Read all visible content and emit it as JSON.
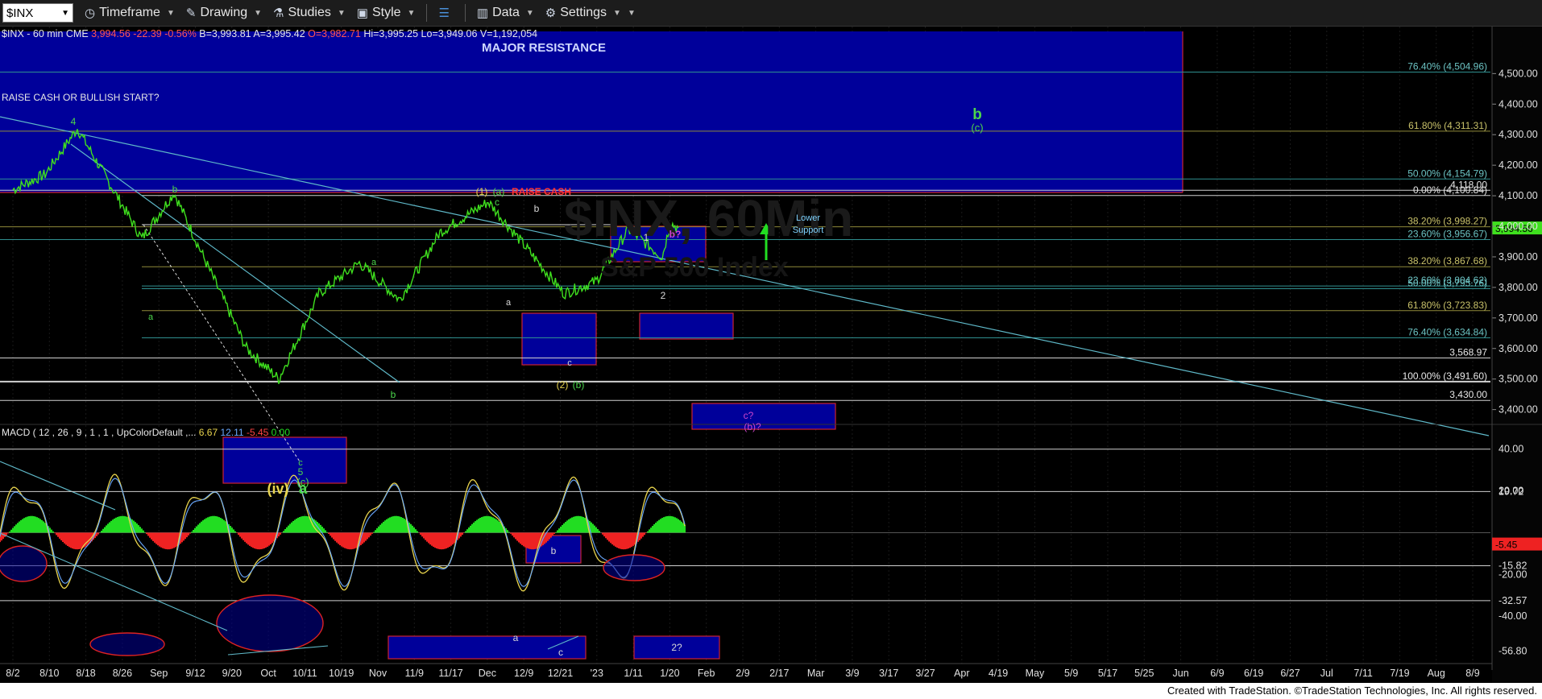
{
  "toolbar": {
    "symbol": "$INX",
    "items": [
      {
        "label": "Timeframe",
        "icon": "clock-icon"
      },
      {
        "label": "Drawing",
        "icon": "pencil-icon"
      },
      {
        "label": "Studies",
        "icon": "flask-icon"
      },
      {
        "label": "Style",
        "icon": "style-icon"
      },
      {
        "label": "",
        "icon": "layout-icon"
      },
      {
        "label": "Data",
        "icon": "data-bars-icon"
      },
      {
        "label": "Settings",
        "icon": "gear-icon"
      }
    ]
  },
  "header": {
    "symbol": "$INX - 60 min",
    "exchange": "CME",
    "last": "3,994.56",
    "change": "-22.39",
    "pct": "-0.56%",
    "b": "B=3,993.81",
    "a": "A=3,995.42",
    "o": "O=3,982.71",
    "hi": "Hi=3,995.25",
    "lo": "Lo=3,949.06",
    "v": "V=1,192,054"
  },
  "watermark": {
    "line1": "$INX, 60Min",
    "line2": "S&P 500 Index"
  },
  "colors": {
    "resistance_box": "#00009a",
    "trendline": "#5fb9c9",
    "price": "#3fe01e",
    "fib": "#7a7a3a",
    "wave_label": "#5fd35f",
    "bg": "#000000"
  },
  "chart_data": [
    {
      "type": "line",
      "title": "$INX - 60 min",
      "x_ticks": [
        "8/2",
        "8/10",
        "8/18",
        "8/26",
        "Sep",
        "9/12",
        "9/20",
        "Oct",
        "10/11",
        "10/19",
        "Nov",
        "11/9",
        "11/17",
        "Dec",
        "12/9",
        "12/21",
        "'23",
        "1/11",
        "1/20",
        "Feb",
        "2/9",
        "2/17",
        "Mar",
        "3/9",
        "3/17",
        "3/27",
        "Apr",
        "4/19",
        "May",
        "5/9",
        "5/17",
        "5/25",
        "Jun",
        "6/9",
        "6/19",
        "6/27",
        "Jul",
        "7/11",
        "7/19",
        "Aug",
        "8/9"
      ],
      "y_ticks": [
        "3,400.00",
        "3,500.00",
        "3,600.00",
        "3,700.00",
        "3,800.00",
        "3,900.00",
        "4,000.00",
        "4,100.00",
        "4,200.00",
        "4,300.00",
        "4,400.00",
        "4,500.00"
      ],
      "ylim": [
        3370,
        4580
      ],
      "price_path": [
        {
          "x": "8/2",
          "y": 4120
        },
        {
          "x": "8/10",
          "y": 4170
        },
        {
          "x": "8/18",
          "y": 4320
        },
        {
          "x": "8/26",
          "y": 4140
        },
        {
          "x": "Sep",
          "y": 3960
        },
        {
          "x": "9/12",
          "y": 4110
        },
        {
          "x": "9/20",
          "y": 3880
        },
        {
          "x": "Oct",
          "y": 3600
        },
        {
          "x": "10/11",
          "y": 3500
        },
        {
          "x": "10/19",
          "y": 3780
        },
        {
          "x": "Nov",
          "y": 3880
        },
        {
          "x": "11/9",
          "y": 3760
        },
        {
          "x": "11/17",
          "y": 3980
        },
        {
          "x": "Dec",
          "y": 4080
        },
        {
          "x": "12/9",
          "y": 3940
        },
        {
          "x": "12/21",
          "y": 3780
        },
        {
          "x": "'23",
          "y": 3820
        },
        {
          "x": "1/11",
          "y": 3990
        },
        {
          "x": "1/20",
          "y": 3900
        },
        {
          "x": "1/20",
          "y": 4010
        },
        {
          "x": "1/20",
          "y": 3994.56
        }
      ],
      "levels": [
        {
          "label": "76.40% (4,504.96)",
          "y": 4504.96
        },
        {
          "label": "61.80% (4,311.31)",
          "y": 4311.31
        },
        {
          "label": "50.00% (4,154.79)",
          "y": 4154.79
        },
        {
          "label": "4,118.00",
          "y": 4118
        },
        {
          "label": "0.00% (4,100.84)",
          "y": 4100.84
        },
        {
          "label": "38.20% (3,998.27)",
          "y": 3998.27
        },
        {
          "label": "23.60% (3,956.67)",
          "y": 3956.67
        },
        {
          "label": "38.20% (3,867.68)",
          "y": 3867.68
        },
        {
          "label": "23.60% (3,804.62)",
          "y": 3804.62
        },
        {
          "label": "50.00% (3,795.76)",
          "y": 3795.76
        },
        {
          "label": "61.80% (3,723.83)",
          "y": 3723.83
        },
        {
          "label": "76.40% (3,634.84)",
          "y": 3634.84
        },
        {
          "label": "3,568.97",
          "y": 3568.97
        },
        {
          "label": "100.00% (3,491.60)",
          "y": 3491.6
        },
        {
          "label": "3,430.00",
          "y": 3430
        }
      ],
      "last_price": "3,994.56",
      "annotations": [
        {
          "text": "MAJOR RESISTANCE"
        },
        {
          "text": "RAISE CASH OR BULLISH START?"
        },
        {
          "text": "RAISE CASH"
        },
        {
          "text": "Lower"
        },
        {
          "text": "Support"
        },
        {
          "text": "b"
        },
        {
          "text": "(c)"
        },
        {
          "text": "4"
        },
        {
          "text": "(1)"
        },
        {
          "text": "(a)"
        },
        {
          "text": "c"
        },
        {
          "text": "1"
        },
        {
          "text": "b?"
        },
        {
          "text": "2"
        },
        {
          "text": "a"
        },
        {
          "text": "(2)"
        },
        {
          "text": "(b)"
        },
        {
          "text": "c?"
        },
        {
          "text": "(b)?"
        },
        {
          "text": "5"
        },
        {
          "text": "(iv)"
        }
      ]
    },
    {
      "type": "line",
      "title": "MACD ( 12 , 26 , 9 , 1 , 1 , UpColorDefault ,...",
      "legend_values": [
        "6.67",
        "12.11",
        "-5.45",
        "0.00"
      ],
      "y_ticks": [
        "40.00",
        "19.72",
        "20.00",
        "-15.82",
        "-20.00",
        "-32.57",
        "-40.00",
        "-56.80"
      ],
      "ylim": [
        -60,
        48
      ],
      "last_value": "-5.45",
      "annotations": [
        {
          "text": "b"
        },
        {
          "text": "a"
        },
        {
          "text": "c"
        },
        {
          "text": "2?"
        }
      ]
    }
  ],
  "footer": "Created with TradeStation. ©TradeStation Technologies, Inc. All rights reserved."
}
